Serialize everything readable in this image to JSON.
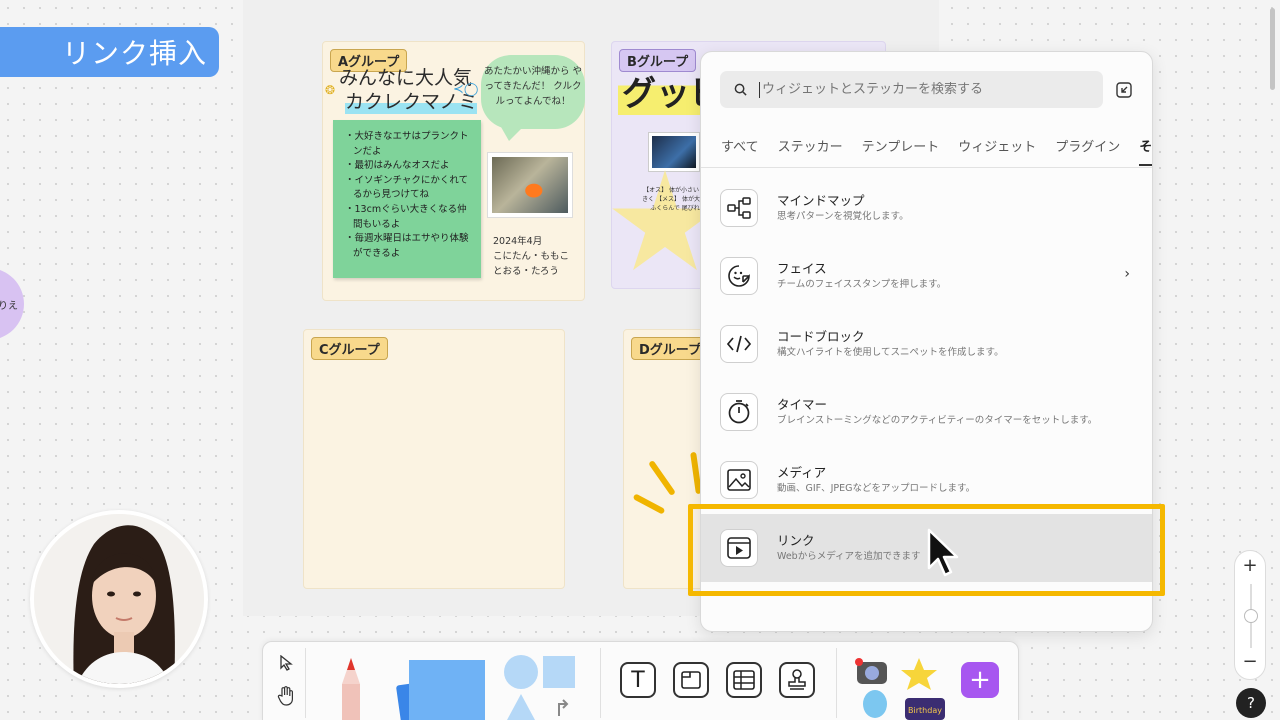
{
  "title_badge": "リンク挿入",
  "left_blob_text": "りえ",
  "board": {
    "group_a": {
      "label": "Aグループ",
      "title_line1": "みんなに大人気",
      "title_line2": "カクレクマノミ",
      "speech": "あたたかい沖縄から やってきたんだ！ クルクルってよんでね！",
      "notes": [
        "大好きなエサはプランクトンだよ",
        "最初はみんなオスだよ",
        "イソギンチャクにかくれてるから見つけてね",
        "13cmぐらい大きくなる仲間もいるよ",
        "毎週水曜日はエサやり体験ができるよ"
      ],
      "date": "2024年4月",
      "authors": "こにたん・ももことおる・たろう"
    },
    "group_b": {
      "label": "Bグループ",
      "title": "グッピ",
      "star_text": "【オス】 体が小さい 尾びれが大きく 【メス】 体が大きい お腹がふくらんで 尾びれが小さい"
    },
    "group_c": {
      "label": "Cグループ"
    },
    "group_d": {
      "label": "Dグループ"
    }
  },
  "panel": {
    "search_placeholder": "ウィジェットとステッカーを検索する",
    "tabs": [
      "すべて",
      "ステッカー",
      "テンプレート",
      "ウィジェット",
      "プラグイン",
      "その他"
    ],
    "items": [
      {
        "title": "マインドマップ",
        "desc": "思考パターンを視覚化します。",
        "icon": "mindmap-icon"
      },
      {
        "title": "フェイス",
        "desc": "チームのフェイススタンプを押します。",
        "icon": "face-sticker-icon",
        "chevron": "›"
      },
      {
        "title": "コードブロック",
        "desc": "構文ハイライトを使用してスニペットを作成します。",
        "icon": "code-icon"
      },
      {
        "title": "タイマー",
        "desc": "ブレインストーミングなどのアクティビティーのタイマーをセットします。",
        "icon": "timer-icon"
      },
      {
        "title": "メディア",
        "desc": "動画、GIF、JPEGなどをアップロードします。",
        "icon": "image-icon"
      },
      {
        "title": "リンク",
        "desc": "Webからメディアを追加できます",
        "icon": "link-media-icon"
      }
    ]
  },
  "toolbar": {
    "text_tool": "T",
    "add_label": "+"
  },
  "zoom": {
    "plus": "+",
    "minus": "−"
  },
  "help_label": "?",
  "colors": {
    "accent_blue": "#5b9cf0",
    "highlight_yellow": "#f5b800",
    "add_purple": "#a757f0"
  }
}
